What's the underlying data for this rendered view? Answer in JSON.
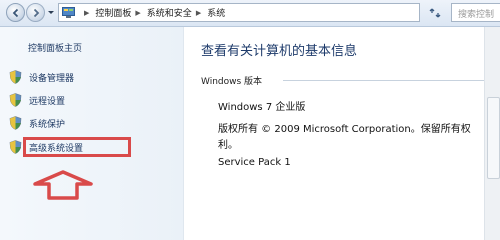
{
  "address_bar": {
    "segments": [
      "控制面板",
      "系统和安全",
      "系统"
    ],
    "search_placeholder": "搜索控制"
  },
  "left_nav": {
    "home_link": "控制面板主页",
    "tasks": [
      {
        "label": "设备管理器",
        "icon": "shield-icon"
      },
      {
        "label": "远程设置",
        "icon": "shield-icon"
      },
      {
        "label": "系统保护",
        "icon": "shield-icon"
      },
      {
        "label": "高级系统设置",
        "icon": "shield-icon"
      }
    ]
  },
  "main": {
    "title": "查看有关计算机的基本信息",
    "group_title": "Windows 版本",
    "edition": "Windows 7 企业版",
    "copyright": "版权所有 © 2009 Microsoft Corporation。保留所有权利。",
    "service_pack": "Service Pack 1"
  },
  "colors": {
    "annotation_red": "#d94a4a",
    "link_blue": "#1f3a64",
    "title_blue": "#1e3b6b"
  }
}
